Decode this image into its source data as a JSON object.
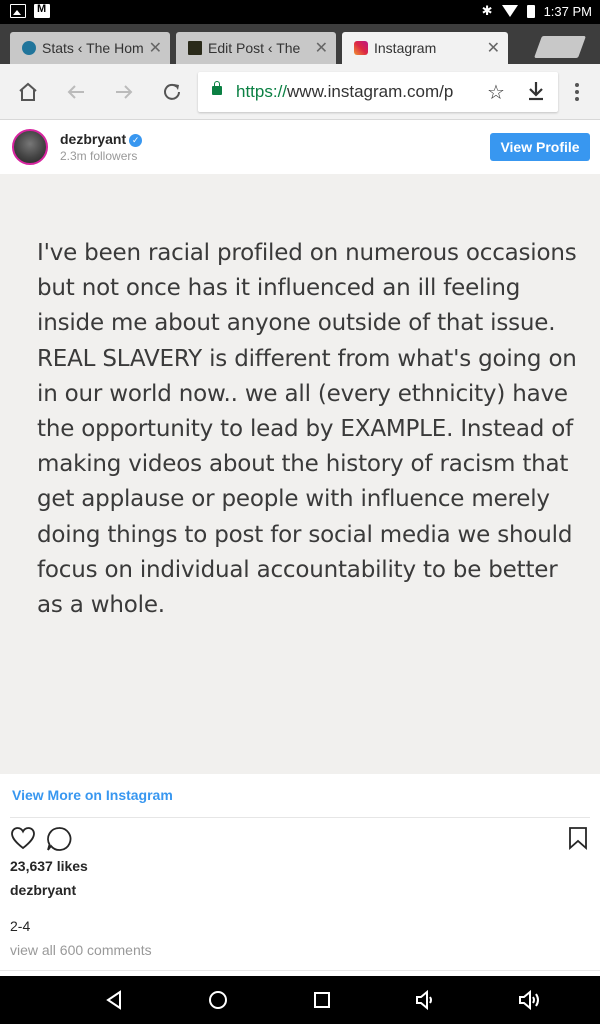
{
  "status_bar": {
    "time": "1:37 PM",
    "icons": [
      "image-icon",
      "gmail-icon",
      "bluetooth-icon",
      "wifi-icon",
      "battery-icon"
    ]
  },
  "tabs": [
    {
      "title": "Stats ‹ The Hom",
      "icon": "wordpress-icon",
      "active": false
    },
    {
      "title": "Edit Post ‹ The",
      "icon": "site-favicon",
      "active": false
    },
    {
      "title": "Instagram",
      "icon": "instagram-icon",
      "active": true
    }
  ],
  "toolbar": {
    "url_scheme": "https://",
    "url_rest": "www.instagram.com/p"
  },
  "post": {
    "username": "dezbryant",
    "followers": "2.3m followers",
    "view_profile_label": "View Profile",
    "image_text": "I've been racial profiled on numerous occasions but not once has it influenced an ill feeling inside me about anyone outside of that issue. REAL SLAVERY is different from what's going on in our world now.. we all (every ethnicity) have the opportunity to lead by EXAMPLE. Instead of making videos about the history of racism that get applause or people with influence merely doing things to post for social media we should focus on individual accountability to be better as a whole.",
    "view_more_label": "View More on Instagram",
    "likes": "23,637 likes",
    "caption_user": "dezbryant",
    "date": "2-4",
    "view_comments": "view all 600 comments"
  },
  "colors": {
    "accent": "#3897f0",
    "secure_green": "#0b8043",
    "post_background": "#f1f0ee"
  }
}
